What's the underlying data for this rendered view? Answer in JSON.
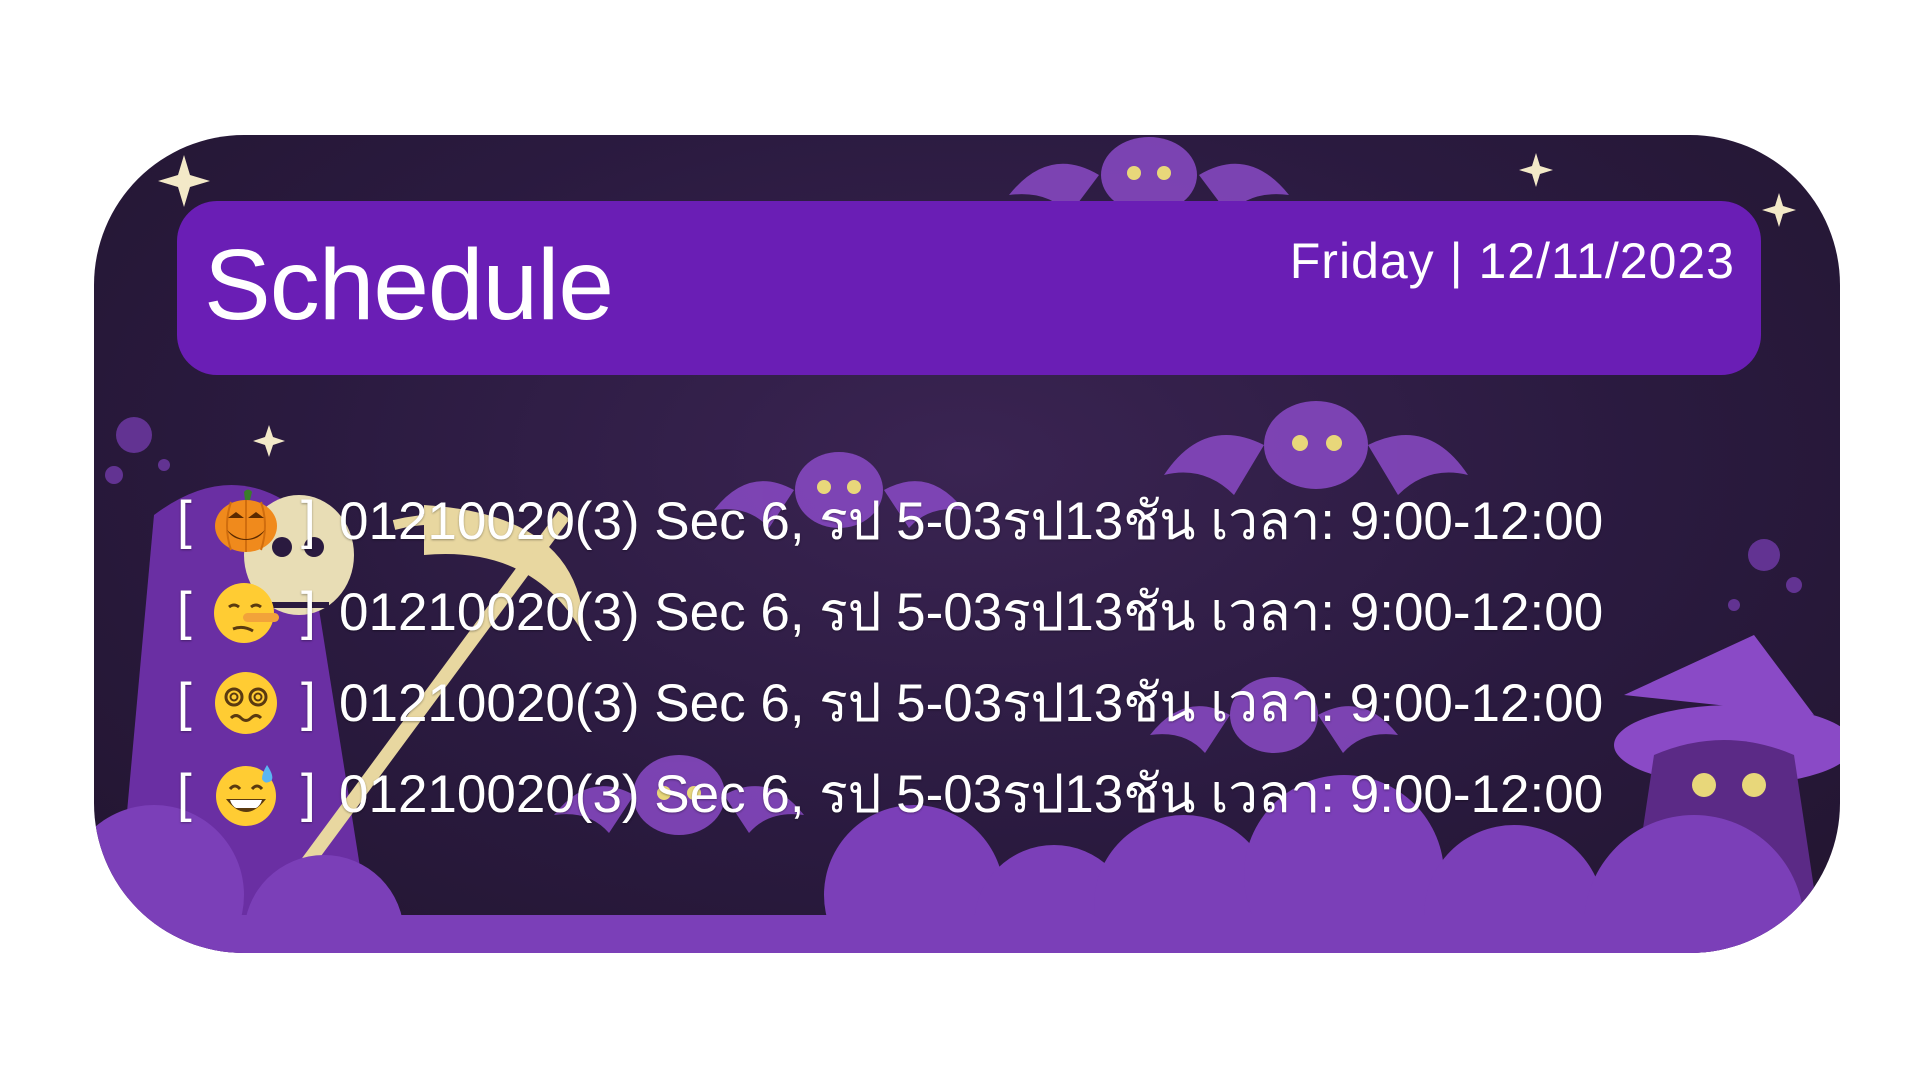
{
  "header": {
    "title": "Schedule",
    "date": "Friday | 12/11/2023"
  },
  "rows": [
    {
      "open": "[",
      "icon": "jack-o-lantern-icon",
      "close": "]",
      "text": "01210020(3) Sec 6, รป 5-03รป13ชัน เวลา: 9:00-12:00"
    },
    {
      "open": "[",
      "icon": "lying-face-icon",
      "close": "]",
      "text": "01210020(3) Sec 6, รป 5-03รป13ชัน เวลา: 9:00-12:00"
    },
    {
      "open": "[",
      "icon": "dizzy-face-icon",
      "close": "]",
      "text": "01210020(3) Sec 6, รป 5-03รป13ชัน เวลา: 9:00-12:00"
    },
    {
      "open": "[",
      "icon": "grinning-sweat-icon",
      "close": "]",
      "text": "01210020(3) Sec 6, รป 5-03รป13ชัน เวลา: 9:00-12:00"
    }
  ],
  "colors": {
    "header_bg": "#6a1eb5",
    "widget_bg": "#2a1a3f",
    "accent_purple": "#7b3fb8",
    "text": "#ffffff"
  }
}
